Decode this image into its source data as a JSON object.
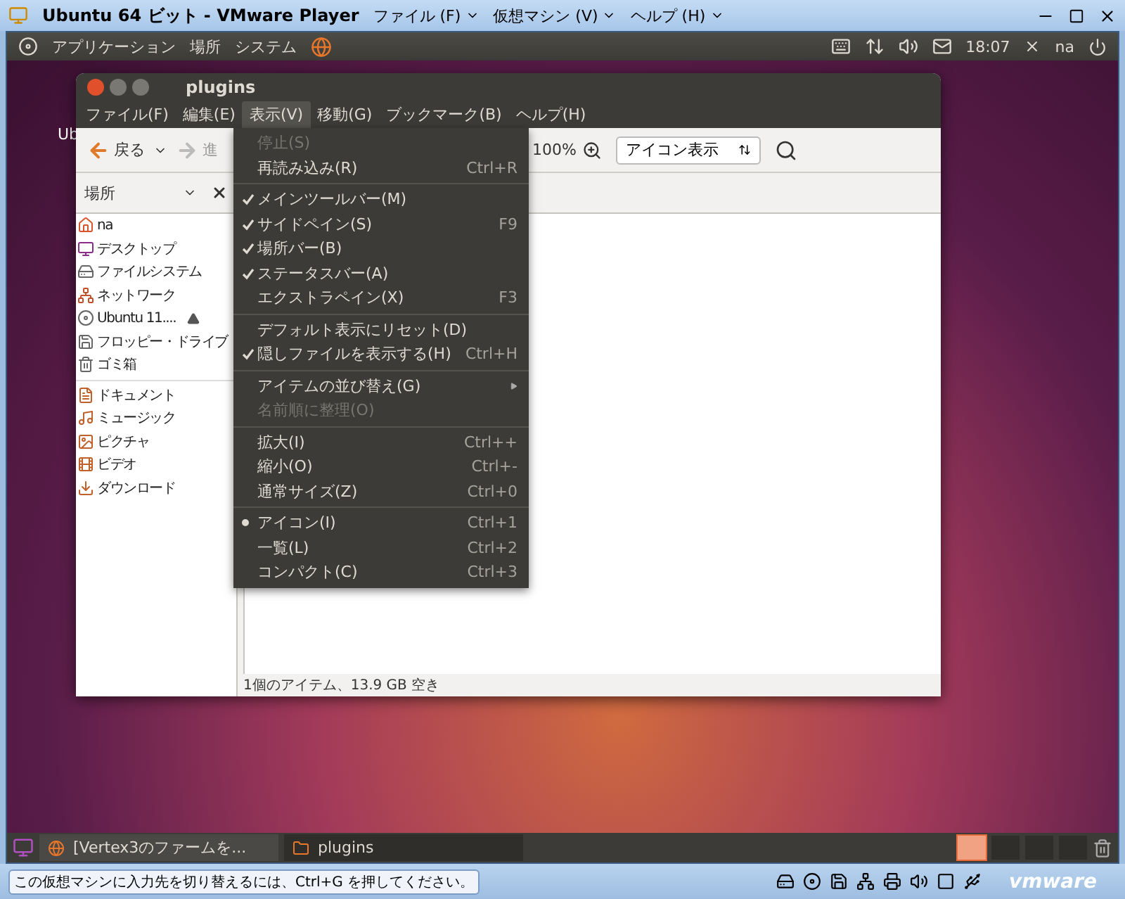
{
  "vm_window": {
    "title": "Ubuntu 64 ビット - VMware Player",
    "menus": [
      "ファイル (F)",
      "仮想マシン (V)",
      "ヘルプ (H)"
    ]
  },
  "top_panel": {
    "menus": [
      "アプリケーション",
      "場所",
      "システム"
    ],
    "clock": "18:07",
    "user": "na"
  },
  "desktop": {
    "icon_label": "Ub"
  },
  "file_manager": {
    "title": "plugins",
    "menubar": [
      {
        "label": "ファイル(F)",
        "selected": false
      },
      {
        "label": "編集(E)",
        "selected": false
      },
      {
        "label": "表示(V)",
        "selected": true
      },
      {
        "label": "移動(G)",
        "selected": false
      },
      {
        "label": "ブックマーク(B)",
        "selected": false
      },
      {
        "label": "ヘルプ(H)",
        "selected": false
      }
    ],
    "toolbar": {
      "back": "戻る",
      "forward": "進",
      "zoom": "100%",
      "view_mode": "アイコン表示"
    },
    "sidebar": {
      "header": "場所",
      "sections": [
        [
          {
            "label": "na"
          },
          {
            "label": "デスクトップ"
          },
          {
            "label": "ファイルシステム"
          },
          {
            "label": "ネットワーク"
          },
          {
            "label": "Ubuntu 11....",
            "kind": "ejectable"
          },
          {
            "label": "フロッピー・ドライブ"
          },
          {
            "label": "ゴミ箱"
          }
        ],
        [
          {
            "label": "ドキュメント"
          },
          {
            "label": "ミュージック"
          },
          {
            "label": "ピクチャ"
          },
          {
            "label": "ビデオ"
          },
          {
            "label": "ダウンロード"
          }
        ]
      ]
    },
    "status": "1個のアイテム、13.9 GB 空き",
    "view_menu": [
      [
        {
          "kind": "plain",
          "label": "停止(S)",
          "disabled": true
        },
        {
          "kind": "plain",
          "label": "再読み込み(R)",
          "shortcut": "Ctrl+R",
          "disabled": false
        }
      ],
      [
        {
          "kind": "check",
          "label": "メインツールバー(M)",
          "checked": true
        },
        {
          "kind": "check",
          "label": "サイドペイン(S)",
          "shortcut": "F9",
          "checked": true
        },
        {
          "kind": "check",
          "label": "場所バー(B)",
          "checked": true
        },
        {
          "kind": "check",
          "label": "ステータスバー(A)",
          "checked": true
        },
        {
          "kind": "check",
          "label": "エクストラペイン(X)",
          "shortcut": "F3",
          "checked": false
        }
      ],
      [
        {
          "kind": "plain",
          "label": "デフォルト表示にリセット(D)",
          "disabled": false
        },
        {
          "kind": "check",
          "label": "隠しファイルを表示する(H)",
          "shortcut": "Ctrl+H",
          "checked": true
        }
      ],
      [
        {
          "kind": "submenu",
          "label": "アイテムの並び替え(G)"
        },
        {
          "kind": "plain",
          "label": "名前順に整理(O)",
          "disabled": true
        }
      ],
      [
        {
          "kind": "plain",
          "label": "拡大(I)",
          "shortcut": "Ctrl++",
          "disabled": false
        },
        {
          "kind": "plain",
          "label": "縮小(O)",
          "shortcut": "Ctrl+-",
          "disabled": false
        },
        {
          "kind": "plain",
          "label": "通常サイズ(Z)",
          "shortcut": "Ctrl+0",
          "disabled": false
        }
      ],
      [
        {
          "kind": "radio",
          "label": "アイコン(I)",
          "shortcut": "Ctrl+1",
          "selected": true
        },
        {
          "kind": "radio",
          "label": "一覧(L)",
          "shortcut": "Ctrl+2",
          "selected": false
        },
        {
          "kind": "radio",
          "label": "コンパクト(C)",
          "shortcut": "Ctrl+3",
          "selected": false
        }
      ]
    ]
  },
  "taskbar": {
    "tasks": [
      {
        "label": "[Vertex3のファームを...",
        "selected": false
      },
      {
        "label": "plugins",
        "selected": true
      }
    ],
    "workspaces": [
      {
        "selected": true
      },
      {
        "selected": false
      },
      {
        "selected": false
      },
      {
        "selected": false
      }
    ]
  },
  "vm_status": {
    "message": "この仮想マシンに入力先を切り替えるには、Ctrl+G を押してください。",
    "logo": "vmware"
  }
}
